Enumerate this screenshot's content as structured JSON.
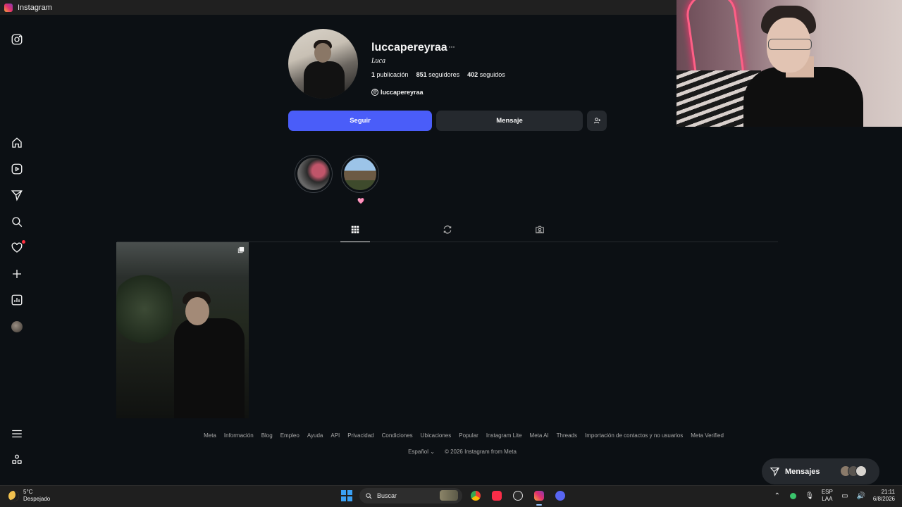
{
  "window": {
    "title": "Instagram"
  },
  "profile": {
    "username": "luccapereyraa",
    "more": "···",
    "full_name": "Luca",
    "posts_count": "1",
    "posts_label": "publicación",
    "followers_count": "851",
    "followers_label": "seguidores",
    "following_count": "402",
    "following_label": "seguidos",
    "threads_handle": "luccapereyraa",
    "follow_button": "Seguir",
    "message_button": "Mensaje"
  },
  "highlights": [
    {
      "label": ""
    },
    {
      "label": "🩷"
    }
  ],
  "tabs": [
    "posts-grid",
    "reels-reposts",
    "tagged"
  ],
  "footer": {
    "links": [
      "Meta",
      "Información",
      "Blog",
      "Empleo",
      "Ayuda",
      "API",
      "Privacidad",
      "Condiciones",
      "Ubicaciones",
      "Popular",
      "Instagram Lite",
      "Meta AI",
      "Threads",
      "Importación de contactos y no usuarios",
      "Meta Verified"
    ],
    "language": "Español",
    "copyright": "© 2026 Instagram from Meta"
  },
  "messages_pill": {
    "label": "Mensajes"
  },
  "taskbar": {
    "temperature": "5°C",
    "weather": "Despejado",
    "search_placeholder": "Buscar",
    "lang_top": "ESP",
    "lang_bottom": "LAA",
    "time": "21:11",
    "date": "6/8/2026"
  },
  "colors": {
    "accent": "#4a5df9",
    "background": "#0c1014",
    "button_secondary": "#25292e",
    "notification": "#ff3040"
  }
}
